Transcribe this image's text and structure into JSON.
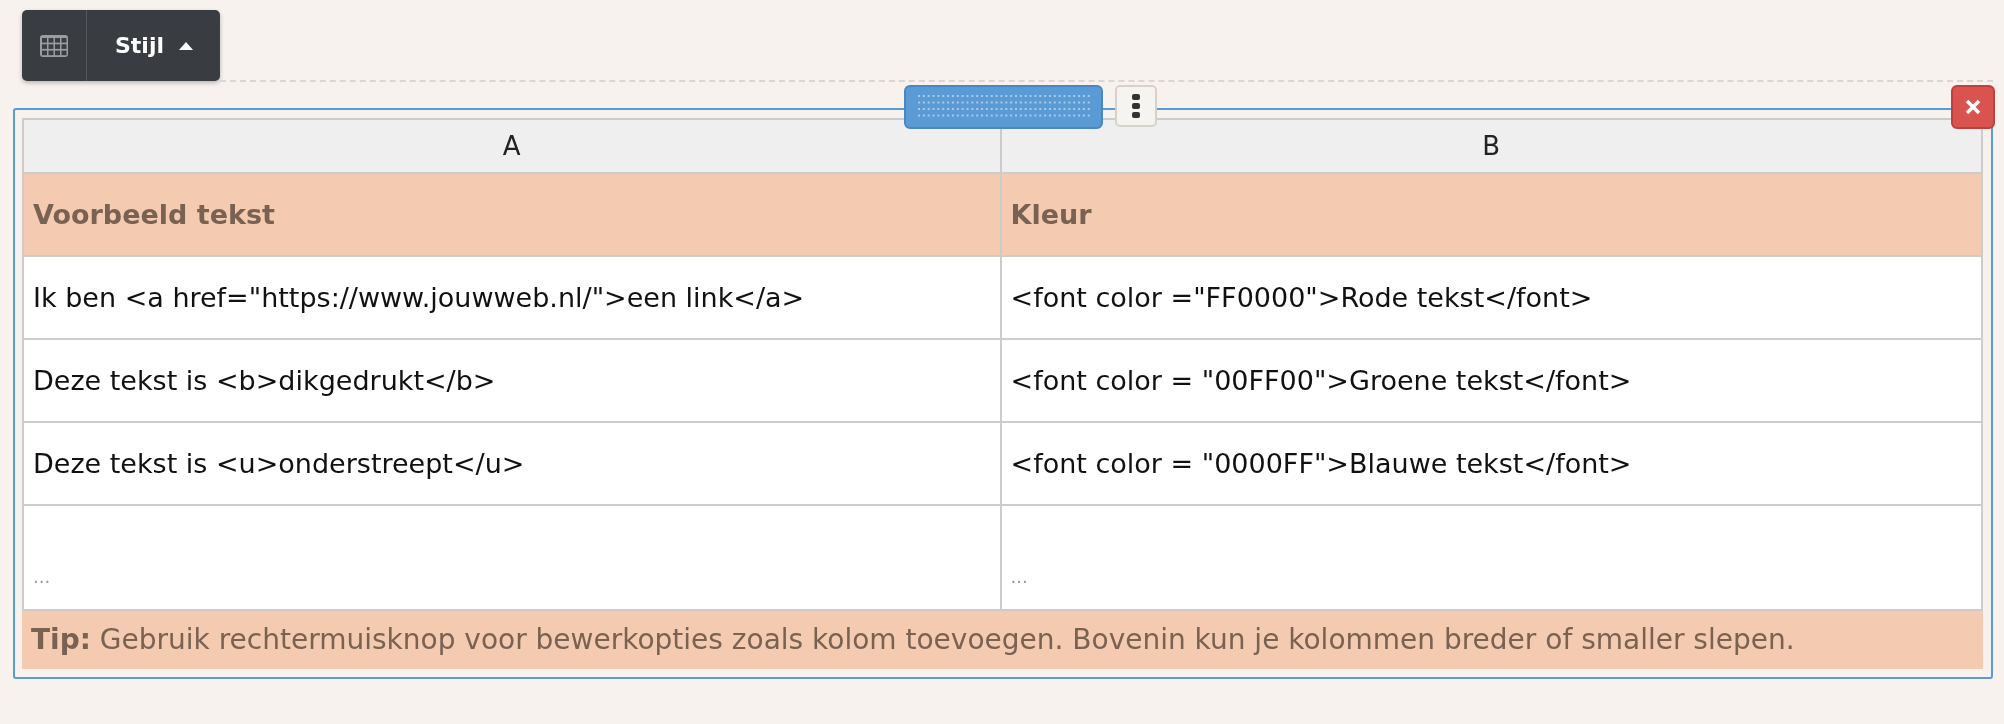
{
  "toolbar": {
    "style_button": "Stijl"
  },
  "table": {
    "columns": [
      "A",
      "B"
    ],
    "rows": [
      {
        "kind": "header",
        "cells": [
          "Voorbeeld tekst",
          "Kleur"
        ]
      },
      {
        "kind": "data",
        "cells": [
          "Ik ben <a href=\"https://www.jouwweb.nl/\">een link</a>",
          "<font color =\"FF0000\">Rode tekst</font>"
        ]
      },
      {
        "kind": "data",
        "cells": [
          "Deze tekst is <b>dikgedrukt</b>",
          "<font color = \"00FF00\">Groene tekst</font>"
        ]
      },
      {
        "kind": "data",
        "cells": [
          "Deze tekst is <u>onderstreept</u>",
          "<font color = \"0000FF\">Blauwe tekst</font>"
        ]
      },
      {
        "kind": "placeholder",
        "cells": [
          "...",
          "..."
        ]
      }
    ]
  },
  "tip": "**Tip:** Gebruik rechtermuisknop voor bewerkopties zoals kolom toevoegen. Bovenin kun je kolommen breder of smaller slepen."
}
